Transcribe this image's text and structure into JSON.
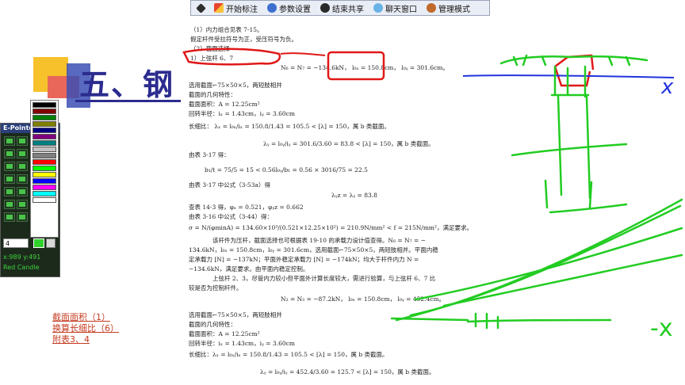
{
  "slide": {
    "title": "五、钢",
    "links": [
      "截面面积（1）",
      "换算长细比（6）",
      "附表3、4"
    ]
  },
  "toolbar": {
    "items": [
      {
        "icon": "pin-icon",
        "label": ""
      },
      {
        "icon": "pen-icon",
        "label": "开始标注"
      },
      {
        "icon": "gear-icon",
        "label": "参数设置"
      },
      {
        "icon": "stop-share-icon",
        "label": "结束共享"
      },
      {
        "icon": "chat-icon",
        "label": "聊天窗口"
      },
      {
        "icon": "admin-icon",
        "label": "管理模式"
      }
    ]
  },
  "epointer": {
    "title": "E-Pointe",
    "size_value": "4",
    "coord": "x:989  y:491",
    "mode": "Red Candle",
    "palette": [
      "#000000",
      "#800000",
      "#008000",
      "#808000",
      "#000080",
      "#800080",
      "#008080",
      "#c0c0c0",
      "#808080",
      "#ff0000",
      "#00ff00",
      "#ffff00",
      "#0000ff",
      "#ff00ff",
      "#00ffff",
      "#ffffff"
    ],
    "current_color": "#31d12d"
  },
  "document": {
    "lines": [
      "（1）内力组合见表 7-15。",
      "假定杆件受拉符号为正，受压符号为负。",
      "（2）截面选择",
      "1）上弦杆 6、7",
      "N₆ = N₇ = −134.6kN，  l₀ₓ = 150.8cm，  l₀ᵧ = 301.6cm。",
      "选用截面⌐75×50×5，两短肢相并",
      "截面的几何特性：",
      "截面面积：A = 12.25cm²",
      "回转半径：iₓ = 1.43cm，iᵧ = 3.60cm",
      "长细比：   λₓ = l₀ₓ/iₓ = 150.8/1.43 = 105.5 < [λ] = 150，属 b 类截面。",
      "λᵧ = l₀ᵧ/iᵧ = 301.6/3.60 = 83.8 < [λ] = 150，属 b 类截面。",
      "由表 3-17 得：",
      "b₁/t = 75/5 = 15 < 0.56l₀ᵧ/b₁ = 0.56 × 3016/75 = 22.5",
      "由表 3-17 中公式（3-53a）得",
      "λᵧz = λᵧ = 83.8",
      "查表 14-3 得，φₓ = 0.521，φᵧz = 0.662",
      "由表 3-16 中公式（3-44）得：",
      "σ = N/(φminA) = 134.60×10³/(0.521×12.25×10²) = 210.9N/mm² < f = 215N/mm²，满足要求。",
      "该杆件为压杆，截面选择也可根据表 19-10 的承载力设计值查得。N₆ = N₇ = −",
      "134.6kN，l₀ₓ = 150.8cm，l₀ᵧ = 301.6cm，选用截面⌐75×50×5，两短肢相并。平面内稳",
      "定承载力 [N] = −137kN；平面外稳定承载力 [N] = −174kN；均大于杆件内力 N =",
      "−134.6kN，满足要求。由平面内稳定控制。",
      "上弦杆 2、3，尽管内力较小但平面外计算长度较大，需进行验算，与上弦杆 6、7 比",
      "较是否为控制杆件。",
      "N₂ = N₃ = −87.2kN，  l₀ₓ = 150.8cm，  l₀ᵧ = 452.4cm。",
      "选用截面⌐75×50×5，两短肢相并",
      "截面的几何特性：",
      "截面面积：A = 12.25cm²",
      "回转半径：iₓ = 1.43cm，iᵧ = 3.60cm",
      "长细比：λₓ = l₀ₓ/iₓ = 150.8/1.43 = 105.5 < [λ] = 150，属 b 类截面。",
      "λᵧ = l₀ᵧ/iᵧ = 452.4/3.60 = 125.7 < [λ] = 150，属 b 类截面。"
    ]
  },
  "annotations": {
    "label_x_top": "x",
    "label_x_bottom": "-x",
    "ink_color_green": "#22cc22",
    "ink_color_red": "#e01818",
    "ink_color_blue": "#2233dd"
  }
}
